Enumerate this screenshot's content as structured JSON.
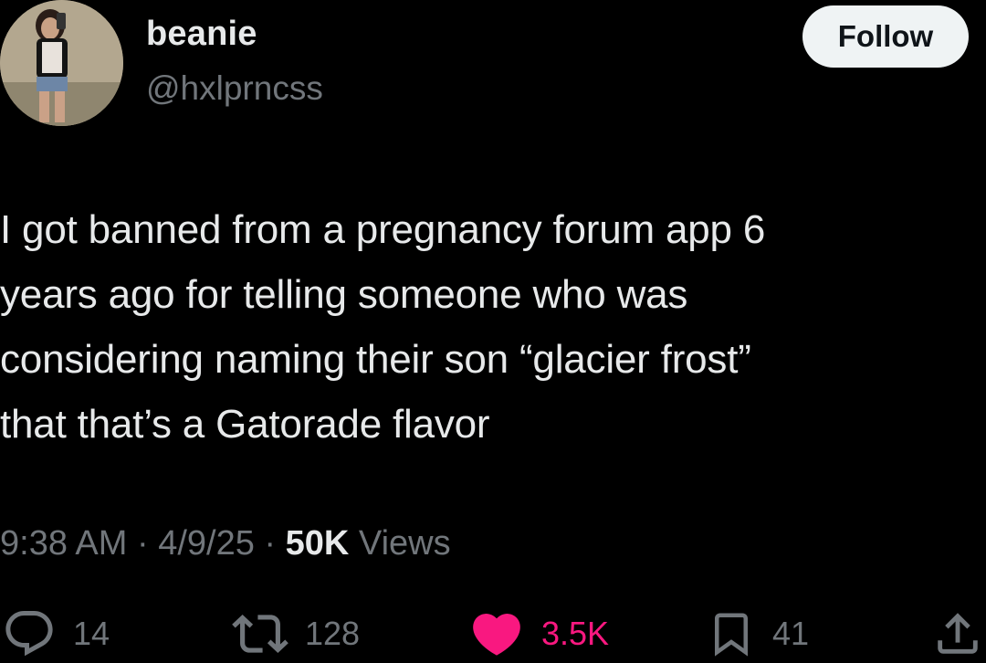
{
  "user": {
    "display_name": "beanie",
    "handle": "@hxlprncss"
  },
  "follow_button": {
    "label": "Follow"
  },
  "tweet": {
    "text": "I got banned from a pregnancy forum app 6\nyears ago for telling someone who was\nconsidering naming their son “glacier frost”\nthat that’s a Gatorade flavor"
  },
  "meta": {
    "time": "9:38 AM",
    "sep1": " · ",
    "date": "4/9/25",
    "sep2": " · ",
    "views_count": "50K",
    "views_label": " Views"
  },
  "actions": {
    "replies": {
      "icon": "reply-icon",
      "count": "14"
    },
    "reposts": {
      "icon": "repost-icon",
      "count": "128"
    },
    "likes": {
      "icon": "heart-icon",
      "count": "3.5K",
      "liked": true
    },
    "bookmarks": {
      "icon": "bookmark-icon",
      "count": "41"
    },
    "share": {
      "icon": "share-icon"
    }
  },
  "colors": {
    "background": "#000000",
    "text_primary": "#e7e9ea",
    "text_secondary": "#71767b",
    "like_active": "#f91880",
    "follow_bg": "#eff3f4"
  }
}
